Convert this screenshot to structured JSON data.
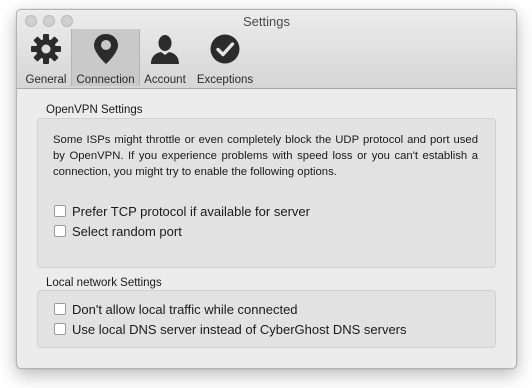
{
  "window": {
    "title": "Settings"
  },
  "toolbar": {
    "items": [
      {
        "label": "General",
        "icon": "gear-icon"
      },
      {
        "label": "Connection",
        "icon": "location-pin-icon",
        "selected": true
      },
      {
        "label": "Account",
        "icon": "user-icon"
      },
      {
        "label": "Exceptions",
        "icon": "check-circle-icon"
      }
    ]
  },
  "openvpn": {
    "title": "OpenVPN Settings",
    "description": "Some ISPs might throttle or even completely block the UDP protocol and port used by OpenVPN. If you experience problems with speed loss or you can't establish a connection, you might try to enable the following options.",
    "options": [
      {
        "label": "Prefer TCP protocol if available for server",
        "checked": false
      },
      {
        "label": "Select random port",
        "checked": false
      }
    ]
  },
  "local_network": {
    "title": "Local network Settings",
    "options": [
      {
        "label": "Don't allow local traffic while connected",
        "checked": false
      },
      {
        "label": "Use local DNS server instead of CyberGhost DNS servers",
        "checked": false
      }
    ]
  }
}
